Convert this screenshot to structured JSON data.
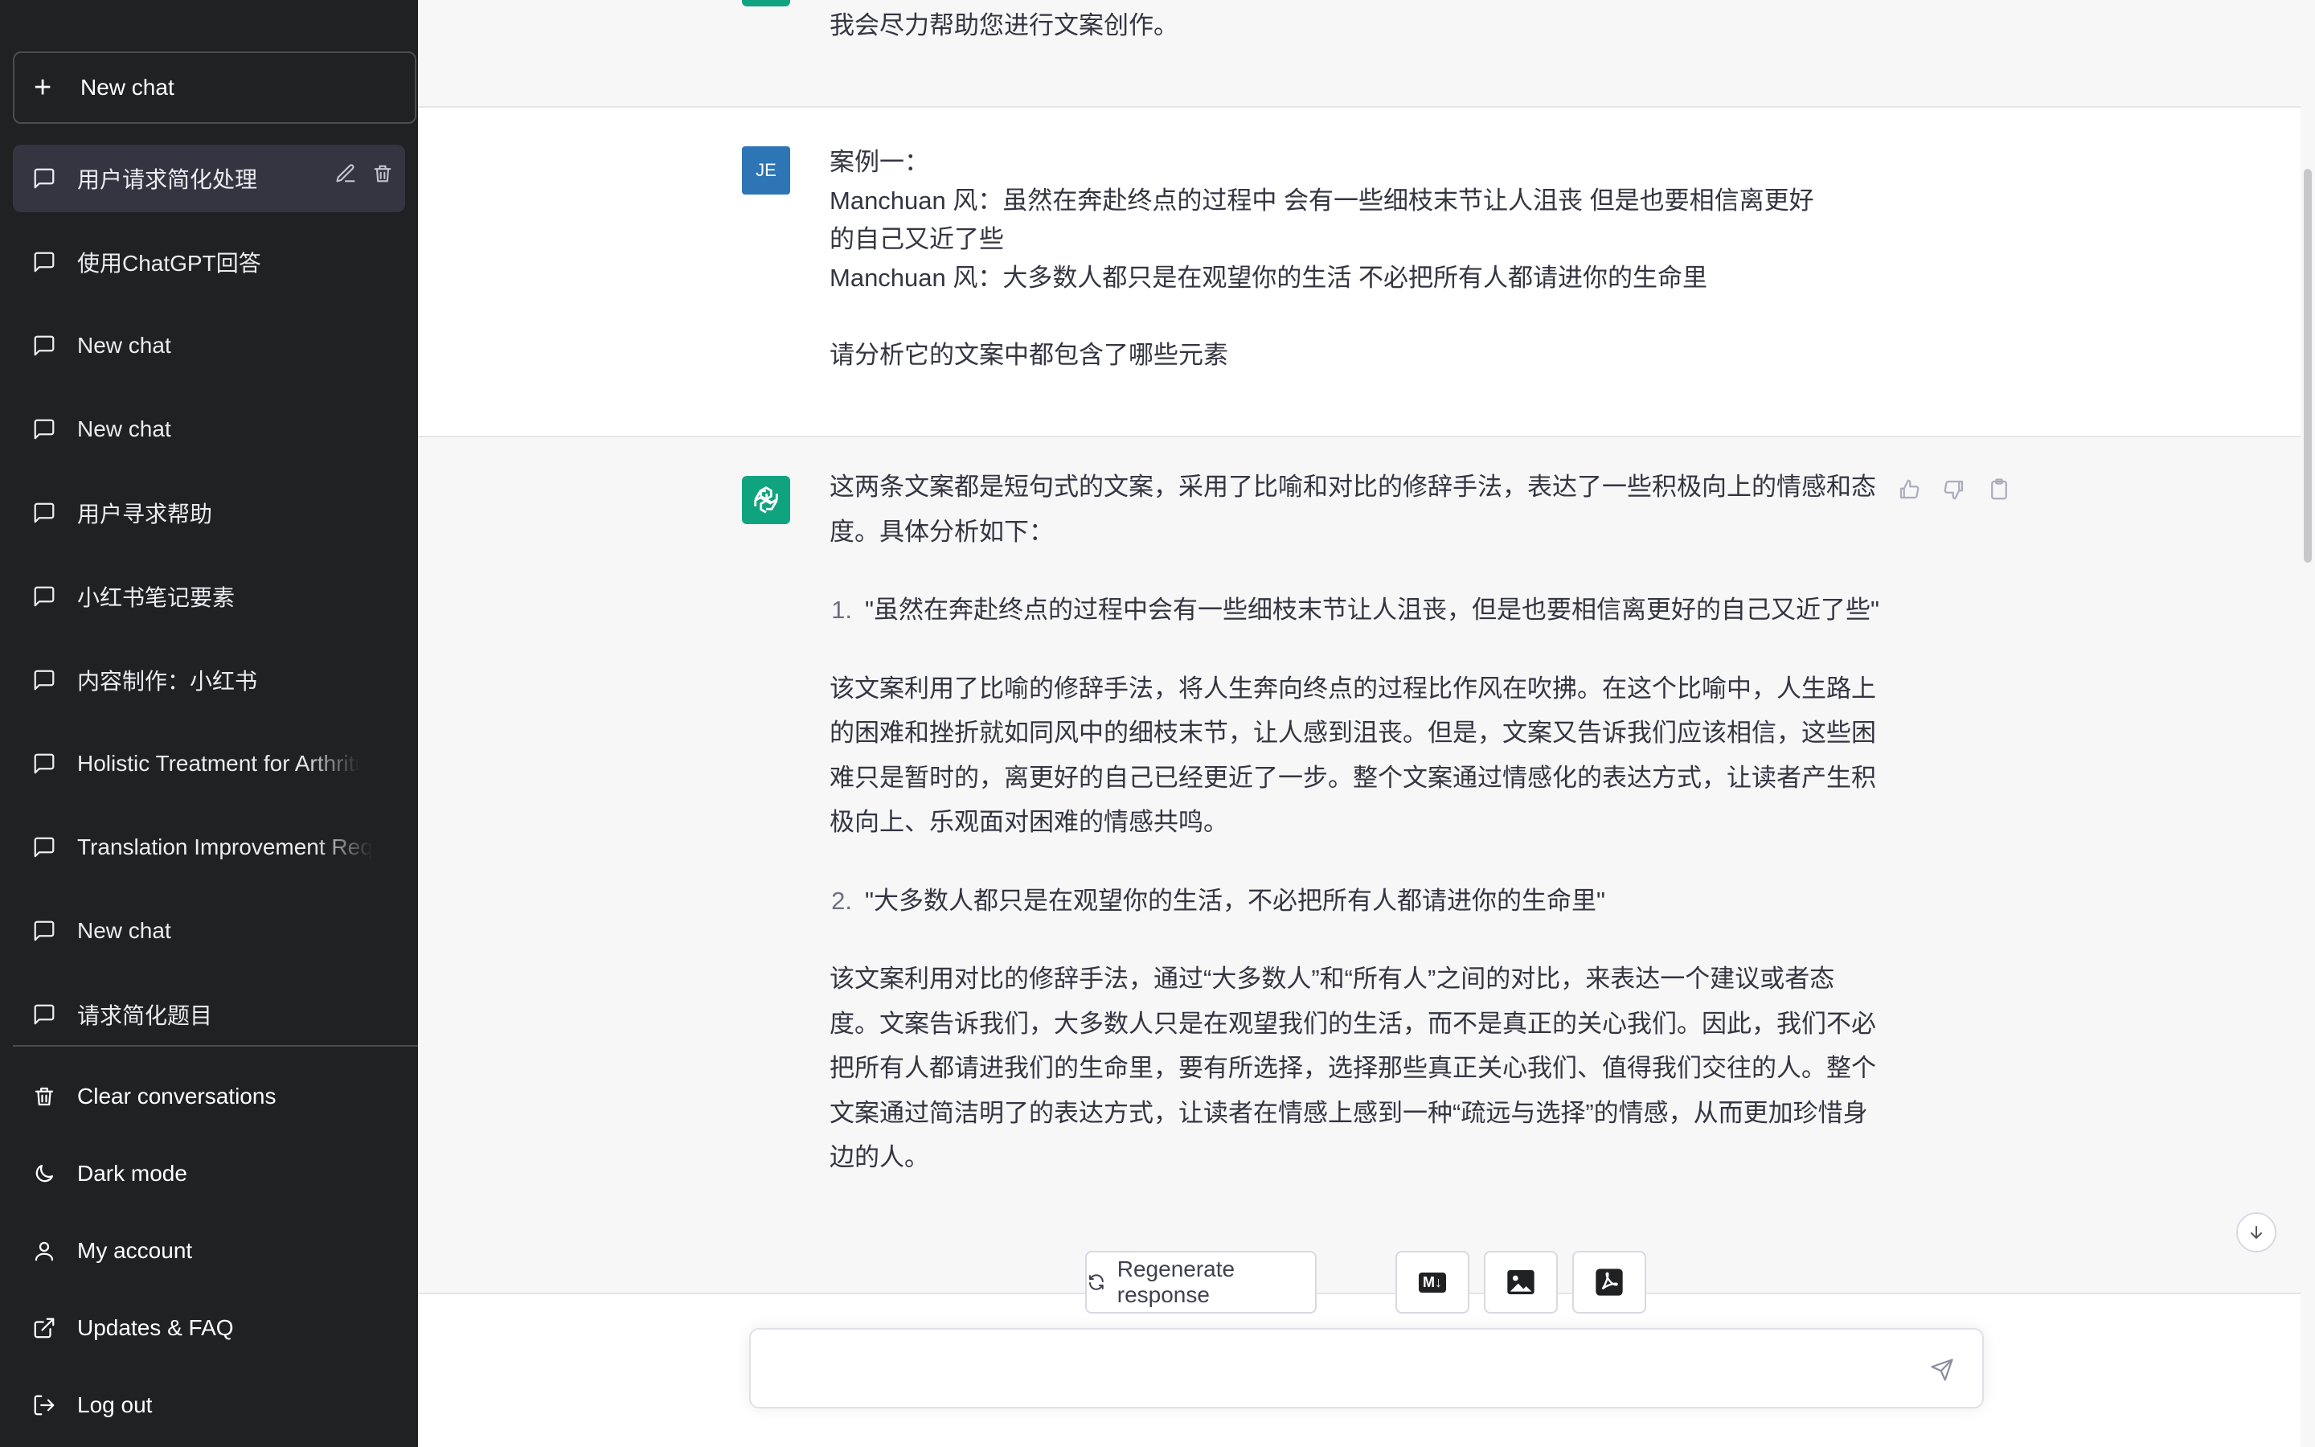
{
  "sidebar": {
    "new_chat_label": "New chat",
    "history": [
      {
        "label": "用户请求简化处理",
        "active": true
      },
      {
        "label": "使用ChatGPT回答"
      },
      {
        "label": "New chat"
      },
      {
        "label": "New chat"
      },
      {
        "label": "用户寻求帮助"
      },
      {
        "label": "小红书笔记要素"
      },
      {
        "label": "内容制作：小红书"
      },
      {
        "label": "Holistic Treatment for Arthriti"
      },
      {
        "label": "Translation Improvement Req"
      },
      {
        "label": "New chat"
      },
      {
        "label": "请求简化题目"
      }
    ],
    "menu": {
      "clear": "Clear conversations",
      "dark_mode": "Dark mode",
      "account": "My account",
      "updates": "Updates & FAQ",
      "logout": "Log out"
    }
  },
  "conversation": {
    "top_message_tail": "我会尽力帮助您进行文案创作。",
    "user": {
      "avatar_initials": "JE",
      "lines": [
        "案例一：",
        "Manchuan 风：虽然在奔赴终点的过程中 会有一些细枝末节让人沮丧 但是也要相信离更好",
        "的自己又近了些",
        "Manchuan 风：大多数人都只是在观望你的生活 不必把所有人都请进你的生命里",
        "",
        "请分析它的文案中都包含了哪些元素"
      ]
    },
    "assistant": {
      "intro": "这两条文案都是短句式的文案，采用了比喻和对比的修辞手法，表达了一些积极向上的情感和态度。具体分析如下：",
      "items": [
        {
          "number": "1.",
          "quote": "\"虽然在奔赴终点的过程中会有一些细枝末节让人沮丧，但是也要相信离更好的自己又近了些\"",
          "analysis": "该文案利用了比喻的修辞手法，将人生奔向终点的过程比作风在吹拂。在这个比喻中，人生路上的困难和挫折就如同风中的细枝末节，让人感到沮丧。但是，文案又告诉我们应该相信，这些困难只是暂时的，离更好的自己已经更近了一步。整个文案通过情感化的表达方式，让读者产生积极向上、乐观面对困难的情感共鸣。"
        },
        {
          "number": "2.",
          "quote": "\"大多数人都只是在观望你的生活，不必把所有人都请进你的生命里\"",
          "analysis": "该文案利用对比的修辞手法，通过“大多数人”和“所有人”之间的对比，来表达一个建议或者态度。文案告诉我们，大多数人只是在观望我们的生活，而不是真正的关心我们。因此，我们不必把所有人都请进我们的生命里，要有所选择，选择那些真正关心我们、值得我们交往的人。整个文案通过简洁明了的表达方式，让读者在情感上感到一种“疏远与选择”的情感，从而更加珍惜身边的人。"
        }
      ]
    }
  },
  "controls": {
    "regenerate_label": "Regenerate response",
    "markdown_badge": "M↓",
    "input_value": ""
  },
  "colors": {
    "sidebar_bg": "#202123",
    "accent": "#10a37f",
    "user_avatar": "#2e75b6"
  }
}
